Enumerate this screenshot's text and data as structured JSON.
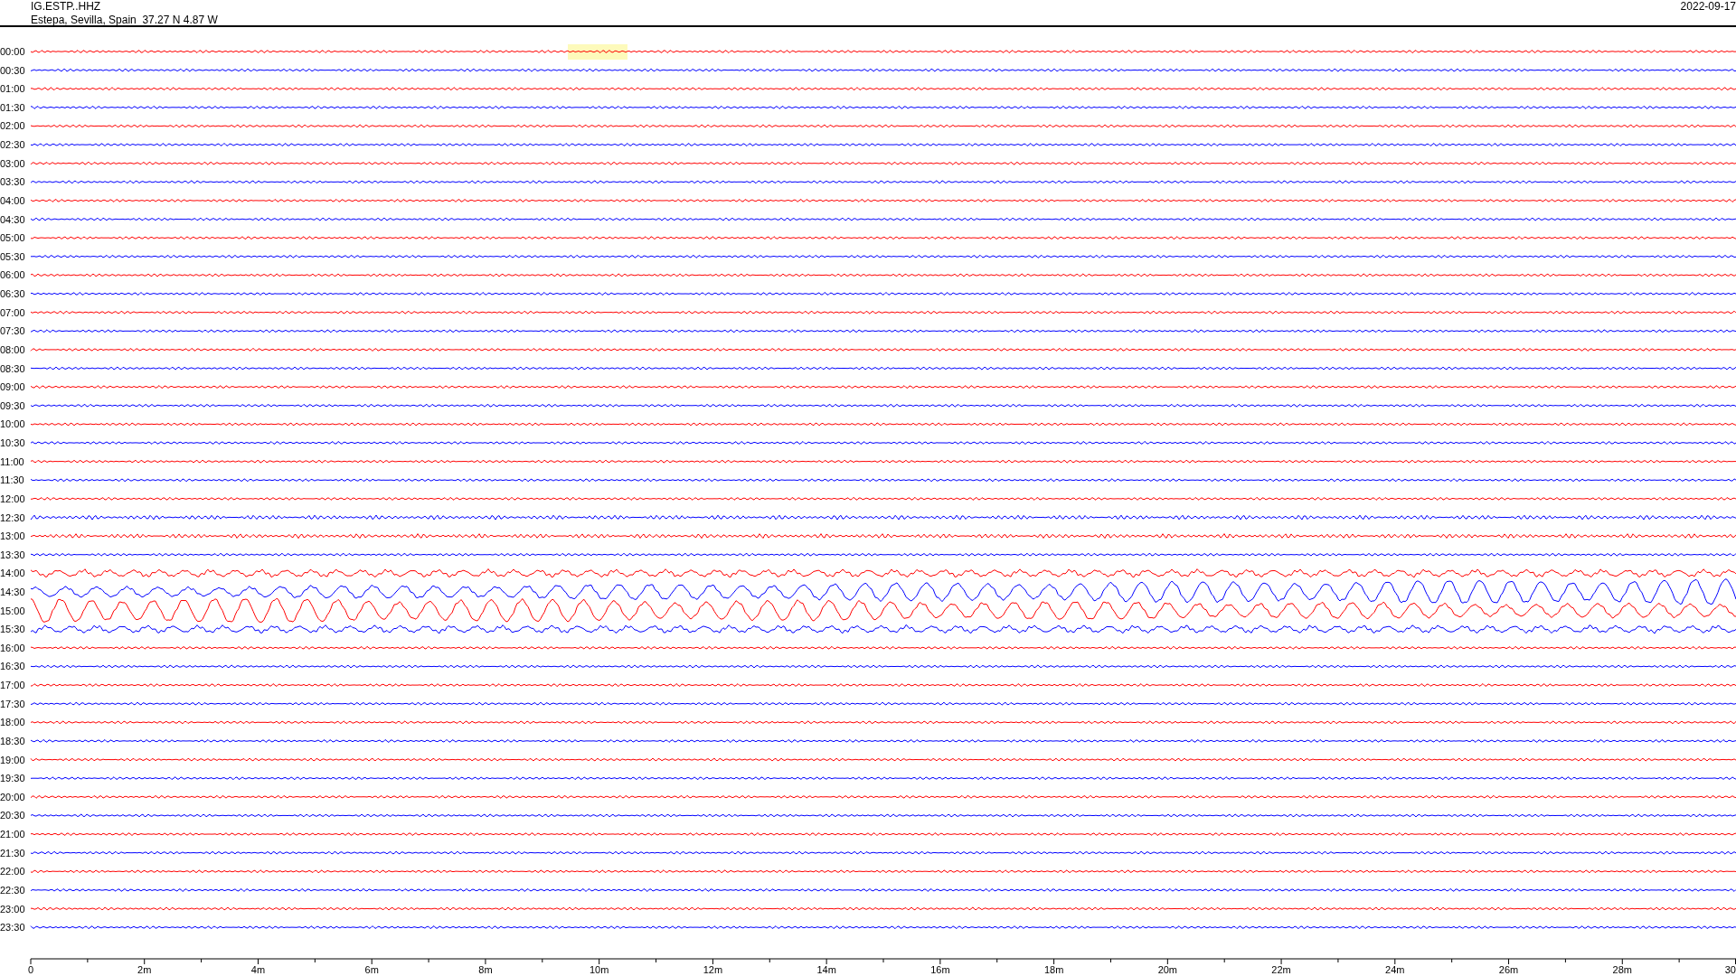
{
  "header": {
    "station": "IG.ESTP..HHZ",
    "location": "Estepa, Sevilla, Spain  37.27 N 4.87 W",
    "date": "2022-09-17"
  },
  "traces": [
    {
      "label": "00:00",
      "color": "#ff0000",
      "kind": "quiet"
    },
    {
      "label": "00:30",
      "color": "#0000ff",
      "kind": "quiet"
    },
    {
      "label": "01:00",
      "color": "#ff0000",
      "kind": "quiet"
    },
    {
      "label": "01:30",
      "color": "#0000ff",
      "kind": "quiet"
    },
    {
      "label": "02:00",
      "color": "#ff0000",
      "kind": "quiet"
    },
    {
      "label": "02:30",
      "color": "#0000ff",
      "kind": "quiet"
    },
    {
      "label": "03:00",
      "color": "#ff0000",
      "kind": "quiet"
    },
    {
      "label": "03:30",
      "color": "#0000ff",
      "kind": "quiet"
    },
    {
      "label": "04:00",
      "color": "#ff0000",
      "kind": "quiet"
    },
    {
      "label": "04:30",
      "color": "#0000ff",
      "kind": "quiet"
    },
    {
      "label": "05:00",
      "color": "#ff0000",
      "kind": "quiet"
    },
    {
      "label": "05:30",
      "color": "#0000ff",
      "kind": "quiet"
    },
    {
      "label": "06:00",
      "color": "#ff0000",
      "kind": "quiet"
    },
    {
      "label": "06:30",
      "color": "#0000ff",
      "kind": "quiet"
    },
    {
      "label": "07:00",
      "color": "#ff0000",
      "kind": "quiet"
    },
    {
      "label": "07:30",
      "color": "#0000ff",
      "kind": "quiet"
    },
    {
      "label": "08:00",
      "color": "#ff0000",
      "kind": "quiet"
    },
    {
      "label": "08:30",
      "color": "#0000ff",
      "kind": "quiet"
    },
    {
      "label": "09:00",
      "color": "#ff0000",
      "kind": "quiet"
    },
    {
      "label": "09:30",
      "color": "#0000ff",
      "kind": "quiet"
    },
    {
      "label": "10:00",
      "color": "#ff0000",
      "kind": "quiet"
    },
    {
      "label": "10:30",
      "color": "#0000ff",
      "kind": "quiet"
    },
    {
      "label": "11:00",
      "color": "#ff0000",
      "kind": "quiet"
    },
    {
      "label": "11:30",
      "color": "#0000ff",
      "kind": "quiet"
    },
    {
      "label": "12:00",
      "color": "#ff0000",
      "kind": "quiet"
    },
    {
      "label": "12:30",
      "color": "#0000ff",
      "kind": "noisy"
    },
    {
      "label": "13:00",
      "color": "#ff0000",
      "kind": "noisy"
    },
    {
      "label": "13:30",
      "color": "#0000ff",
      "kind": "quiet"
    },
    {
      "label": "14:00",
      "color": "#ff0000",
      "kind": "wave"
    },
    {
      "label": "14:30",
      "color": "#0000ff",
      "kind": "strong"
    },
    {
      "label": "15:00",
      "color": "#ff0000",
      "kind": "strong"
    },
    {
      "label": "15:30",
      "color": "#0000ff",
      "kind": "wave"
    },
    {
      "label": "16:00",
      "color": "#ff0000",
      "kind": "quiet"
    },
    {
      "label": "16:30",
      "color": "#0000ff",
      "kind": "quiet"
    },
    {
      "label": "17:00",
      "color": "#ff0000",
      "kind": "quiet"
    },
    {
      "label": "17:30",
      "color": "#0000ff",
      "kind": "quiet"
    },
    {
      "label": "18:00",
      "color": "#ff0000",
      "kind": "quiet"
    },
    {
      "label": "18:30",
      "color": "#0000ff",
      "kind": "quiet"
    },
    {
      "label": "19:00",
      "color": "#ff0000",
      "kind": "quiet"
    },
    {
      "label": "19:30",
      "color": "#0000ff",
      "kind": "quiet"
    },
    {
      "label": "20:00",
      "color": "#ff0000",
      "kind": "quiet"
    },
    {
      "label": "20:30",
      "color": "#0000ff",
      "kind": "quiet"
    },
    {
      "label": "21:00",
      "color": "#ff0000",
      "kind": "quiet"
    },
    {
      "label": "21:30",
      "color": "#0000ff",
      "kind": "quiet"
    },
    {
      "label": "22:00",
      "color": "#ff0000",
      "kind": "quiet"
    },
    {
      "label": "22:30",
      "color": "#0000ff",
      "kind": "quiet"
    },
    {
      "label": "23:00",
      "color": "#ff0000",
      "kind": "quiet"
    },
    {
      "label": "23:30",
      "color": "#0000ff",
      "kind": "quiet"
    }
  ],
  "axis_labels": [
    "0",
    "2m",
    "4m",
    "6m",
    "8m",
    "10m",
    "12m",
    "14m",
    "16m",
    "18m",
    "20m",
    "22m",
    "24m",
    "26m",
    "28m",
    "30"
  ]
}
